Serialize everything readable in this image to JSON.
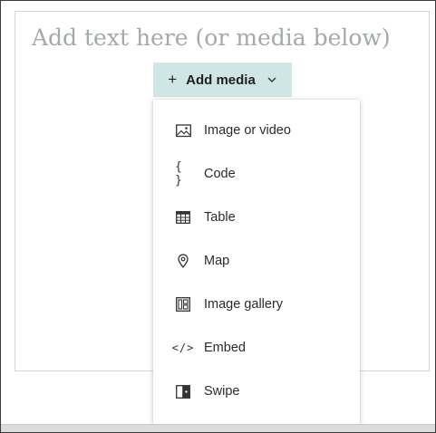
{
  "editor": {
    "placeholder": "Add text here (or media below)"
  },
  "add_media": {
    "plus": "+",
    "label": "Add media",
    "accent": "#cfe7e4"
  },
  "menu": {
    "items": [
      {
        "label": "Image or video",
        "icon": "image-icon"
      },
      {
        "label": "Code",
        "icon": "code-braces-icon",
        "glyph": "{ }"
      },
      {
        "label": "Table",
        "icon": "table-icon"
      },
      {
        "label": "Map",
        "icon": "map-pin-icon"
      },
      {
        "label": "Image gallery",
        "icon": "gallery-icon"
      },
      {
        "label": "Embed",
        "icon": "embed-icon",
        "glyph": "</>"
      },
      {
        "label": "Swipe",
        "icon": "swipe-icon"
      }
    ]
  }
}
